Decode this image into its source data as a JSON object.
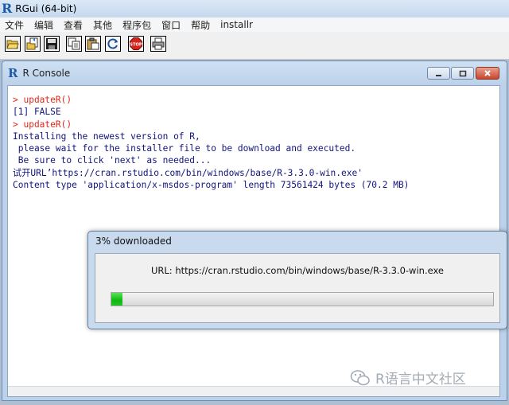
{
  "app": {
    "title": "RGui (64-bit)",
    "logo_letter": "R"
  },
  "menu": [
    "文件",
    "编辑",
    "查看",
    "其他",
    "程序包",
    "窗口",
    "帮助",
    "installr"
  ],
  "toolbar": {
    "buttons": [
      "open-script-icon",
      "load-workspace-icon",
      "save-icon",
      "copy-icon",
      "paste-icon",
      "refresh-icon",
      "stop-icon",
      "print-icon"
    ],
    "stop_label": "STOP"
  },
  "console": {
    "title": "R Console",
    "logo_letter": "R",
    "lines": [
      {
        "kind": "cmd",
        "text": "> updateR()"
      },
      {
        "kind": "out",
        "text": "[1] FALSE"
      },
      {
        "kind": "cmd",
        "text": "> updateR()"
      },
      {
        "kind": "out",
        "text": "Installing the newest version of R,"
      },
      {
        "kind": "out",
        "text": " please wait for the installer file to be download and executed."
      },
      {
        "kind": "out",
        "text": " Be sure to click 'next' as needed..."
      },
      {
        "kind": "out",
        "text": "试开URL’https://cran.rstudio.com/bin/windows/base/R-3.3.0-win.exe'"
      },
      {
        "kind": "out",
        "text": "Content type 'application/x-msdos-program' length 73561424 bytes (70.2 MB)"
      }
    ]
  },
  "progress": {
    "title": "3% downloaded",
    "url_text": "URL: https://cran.rstudio.com/bin/windows/base/R-3.3.0-win.exe",
    "percent": 3
  },
  "watermark": {
    "text": "R语言中文社区"
  },
  "colors": {
    "command": "#e0281b",
    "output": "#13147e",
    "progress_fill": "#0eb80f"
  }
}
